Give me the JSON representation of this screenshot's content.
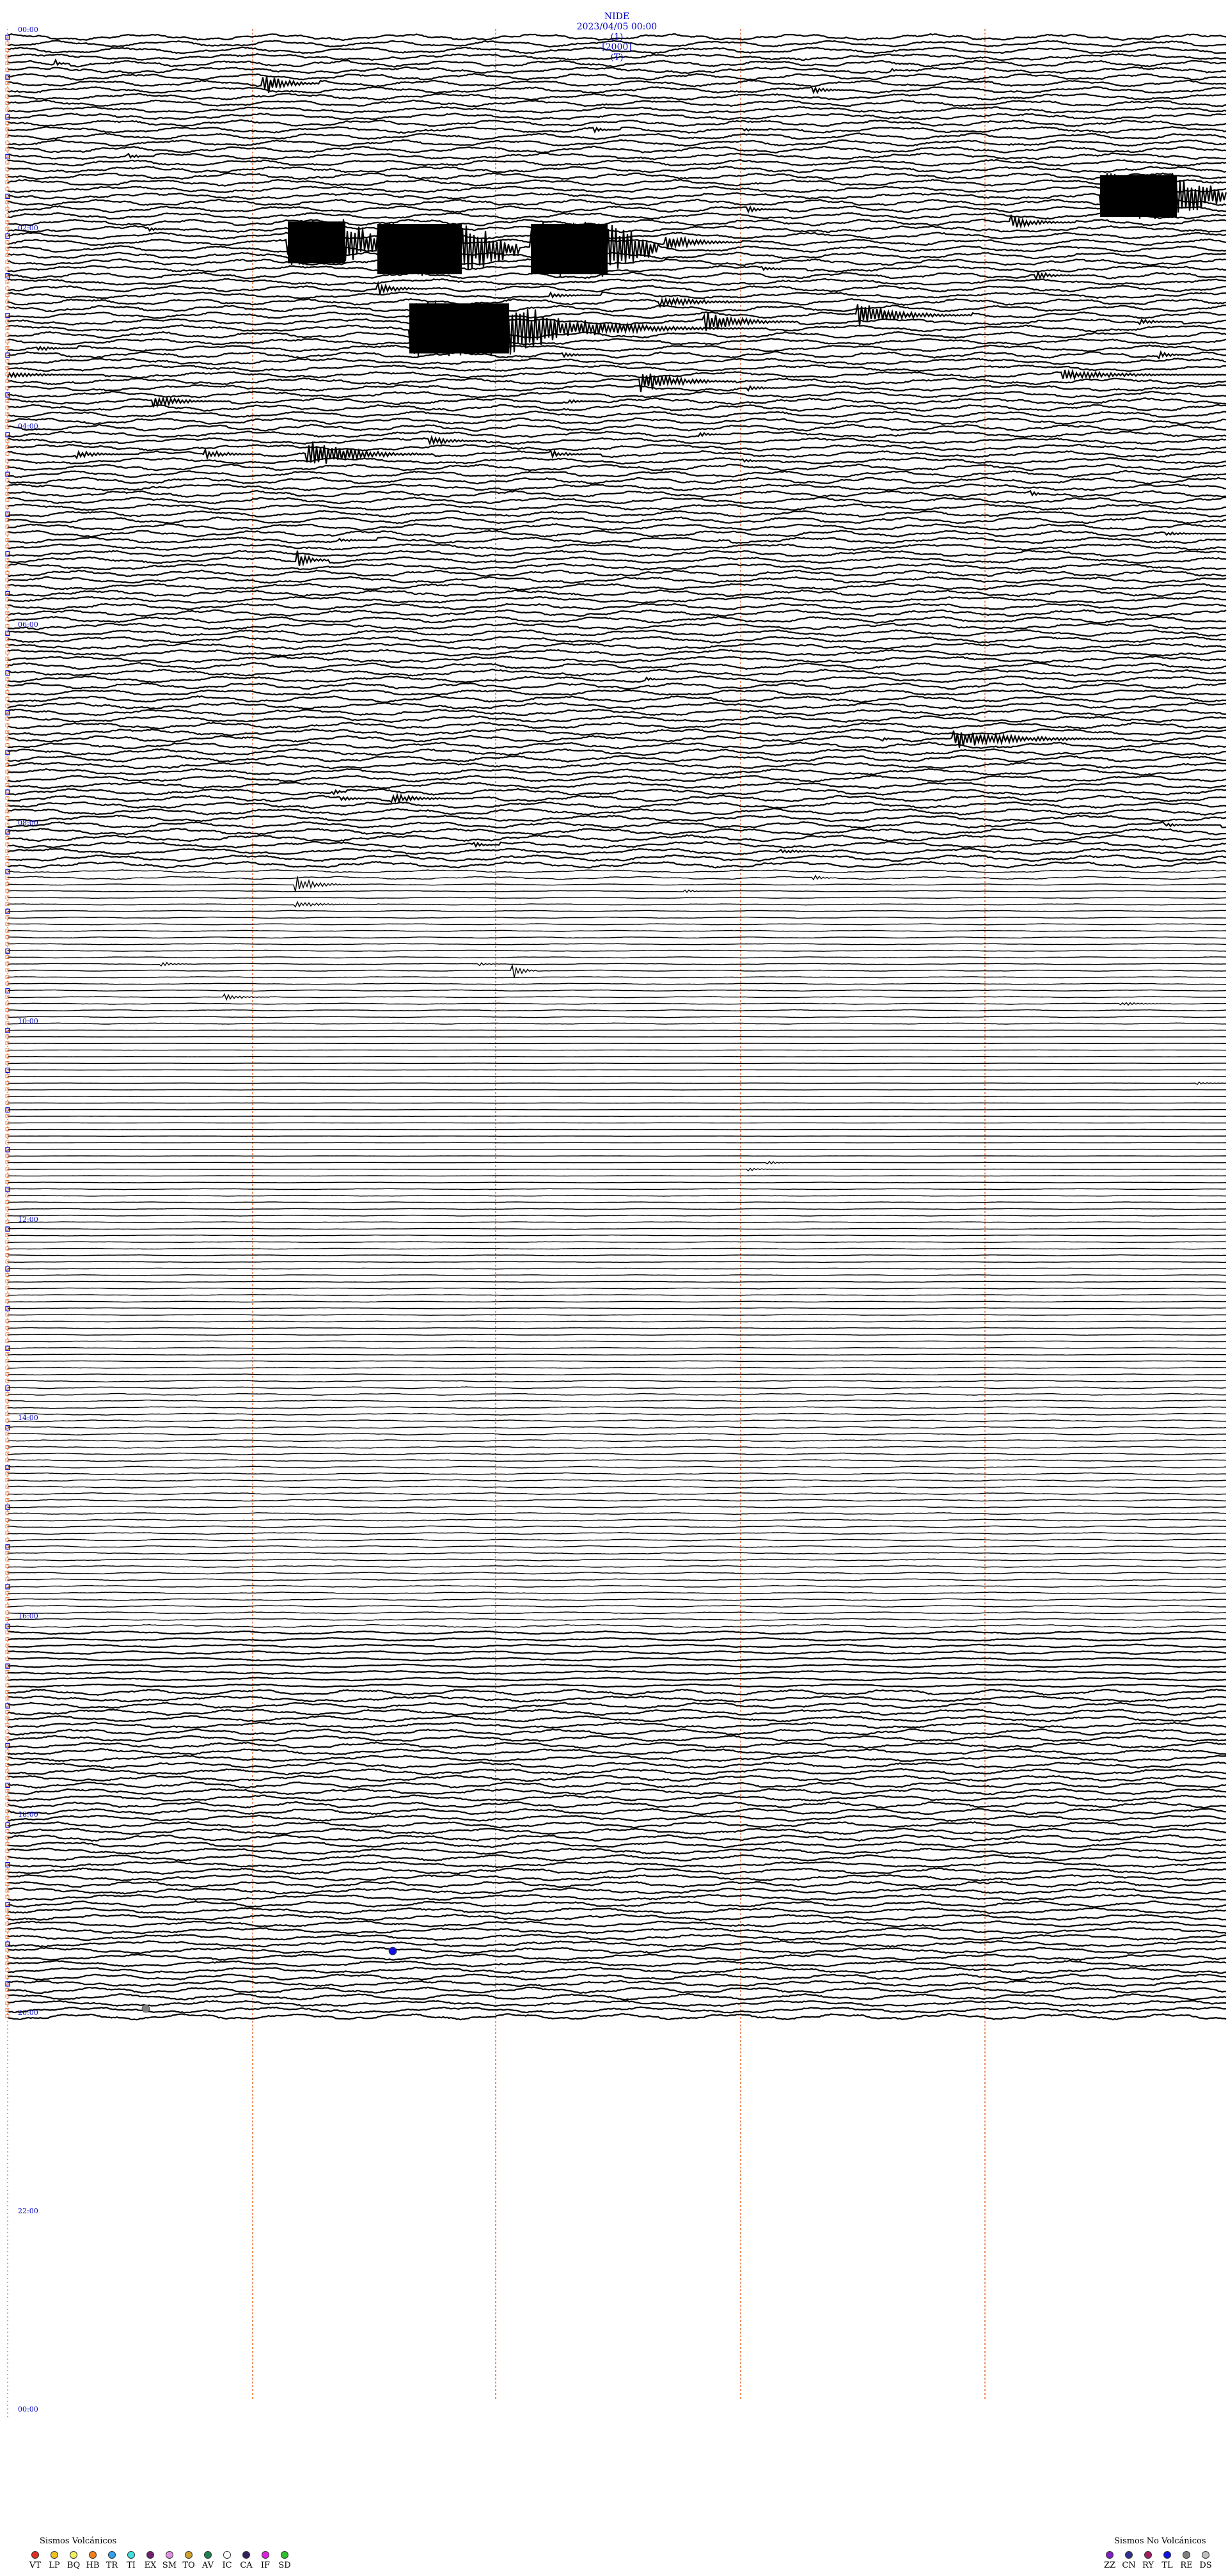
{
  "header": {
    "station": "NIDE",
    "datetime": "2023/04/05 00:00",
    "channel": "(1)",
    "gain": "[2000]",
    "flag": "(T)"
  },
  "time_labels": [
    "00:00",
    "02:00",
    "04:00",
    "06:00",
    "08:00",
    "10:00",
    "12:00",
    "14:00",
    "16:00",
    "18:00",
    "20:00",
    "22:00",
    "00:00"
  ],
  "legend_volcanic": {
    "title": "Sismos Volcánicos",
    "items": [
      {
        "code": "VT",
        "color": "#e03020"
      },
      {
        "code": "LP",
        "color": "#f0c020"
      },
      {
        "code": "BQ",
        "color": "#f0f060"
      },
      {
        "code": "HB",
        "color": "#f08020"
      },
      {
        "code": "TR",
        "color": "#30a0f0"
      },
      {
        "code": "TI",
        "color": "#40e0e0"
      },
      {
        "code": "EX",
        "color": "#702070"
      },
      {
        "code": "SM",
        "color": "#e090e0"
      },
      {
        "code": "TO",
        "color": "#d0a030"
      },
      {
        "code": "AV",
        "color": "#208050"
      },
      {
        "code": "IC",
        "color": "#ffffff"
      },
      {
        "code": "CA",
        "color": "#302060"
      },
      {
        "code": "IF",
        "color": "#e020e0"
      },
      {
        "code": "SD",
        "color": "#30c030"
      }
    ]
  },
  "legend_nonvolcanic": {
    "title": "Sismos No Volcánicos",
    "items": [
      {
        "code": "ZZ",
        "color": "#8020c0"
      },
      {
        "code": "CN",
        "color": "#303090"
      },
      {
        "code": "RY",
        "color": "#a02060"
      },
      {
        "code": "TL",
        "color": "#1010e0"
      },
      {
        "code": "RE",
        "color": "#808080"
      },
      {
        "code": "DS",
        "color": "#c0c0c0"
      }
    ]
  },
  "colors": {
    "trace": "#000000",
    "time_label": "#0000cc",
    "minute_marker": "#e06020",
    "hour_marker": "#cc0000"
  }
}
